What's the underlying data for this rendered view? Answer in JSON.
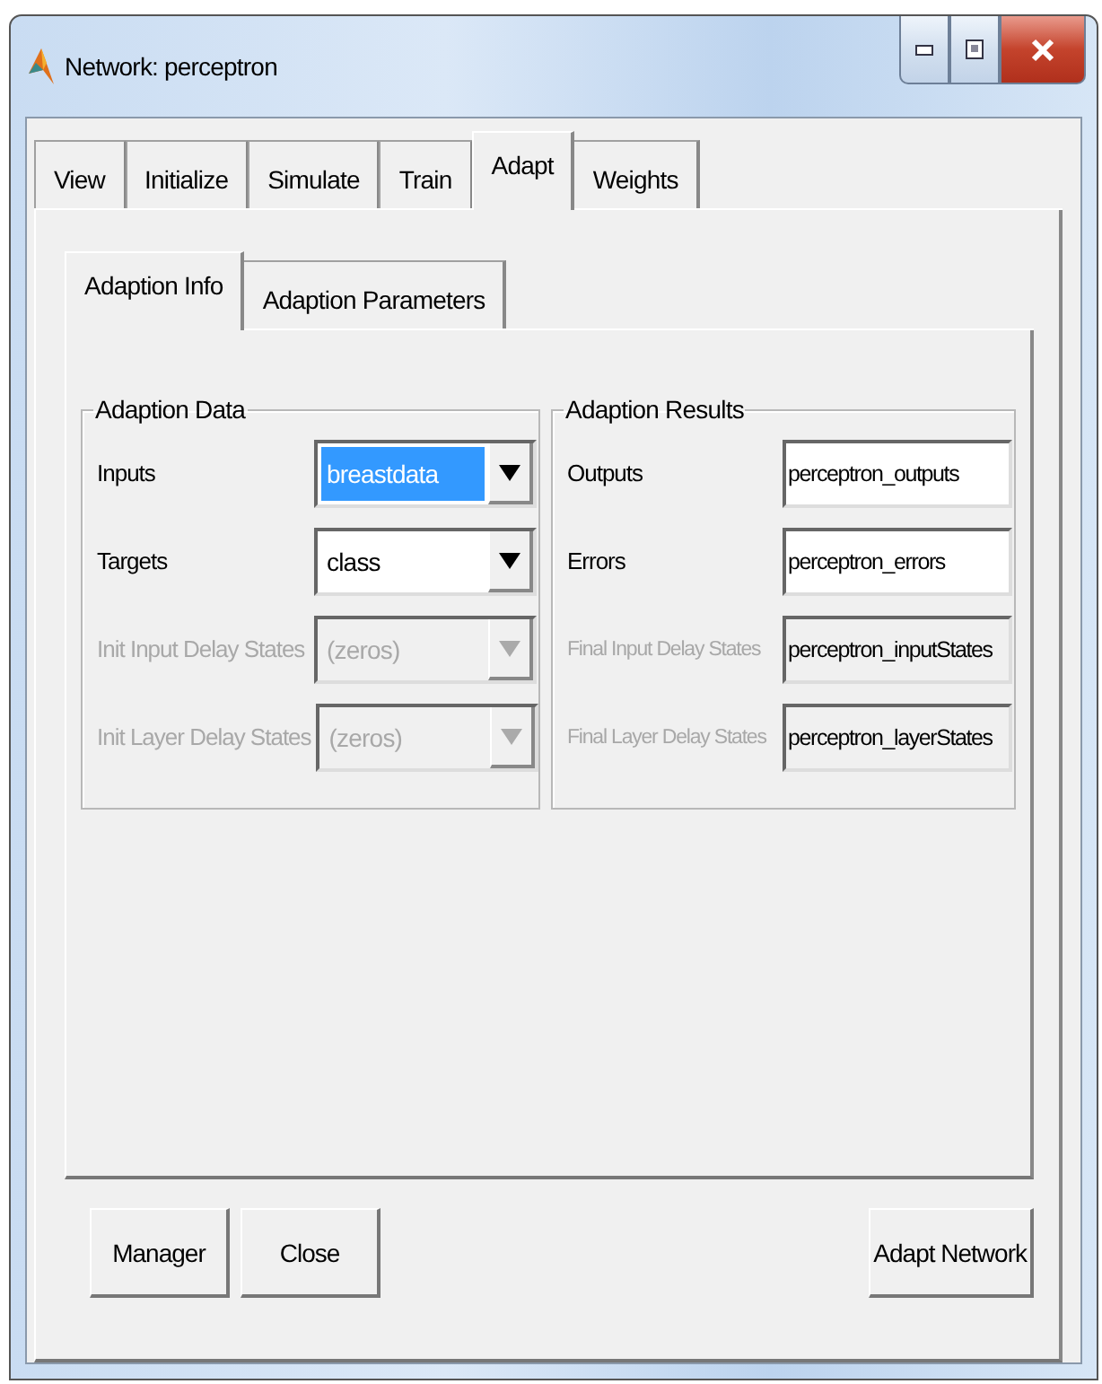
{
  "window": {
    "title": "Network: perceptron"
  },
  "tabs": [
    {
      "label": "View",
      "selected": false
    },
    {
      "label": "Initialize",
      "selected": false
    },
    {
      "label": "Simulate",
      "selected": false
    },
    {
      "label": "Train",
      "selected": false
    },
    {
      "label": "Adapt",
      "selected": true
    },
    {
      "label": "Weights",
      "selected": false
    }
  ],
  "subtabs": [
    {
      "label": "Adaption Info",
      "selected": true
    },
    {
      "label": "Adaption Parameters",
      "selected": false
    }
  ],
  "groups": [
    {
      "title": "Adaption Data",
      "fields": [
        {
          "kind": "dropdown",
          "label": "Inputs",
          "value": "breastdata",
          "disabled": false,
          "highlighted": true
        },
        {
          "kind": "dropdown",
          "label": "Targets",
          "value": "class",
          "disabled": false,
          "highlighted": false
        },
        {
          "kind": "dropdown",
          "label": "Init Input Delay States",
          "value": "(zeros)",
          "disabled": true,
          "highlighted": false
        },
        {
          "kind": "dropdown",
          "label": "Init Layer Delay States",
          "value": "(zeros)",
          "disabled": true,
          "highlighted": false
        }
      ]
    },
    {
      "title": "Adaption Results",
      "fields": [
        {
          "kind": "text",
          "label": "Outputs",
          "value": "perceptron_outputs",
          "disabled": false
        },
        {
          "kind": "text",
          "label": "Errors",
          "value": "perceptron_errors",
          "disabled": false
        },
        {
          "kind": "text",
          "label": "Final Input Delay States",
          "value": "perceptron_inputStates",
          "disabled": true
        },
        {
          "kind": "text",
          "label": "Final Layer Delay States",
          "value": "perceptron_layerStates",
          "disabled": true
        }
      ]
    }
  ],
  "buttons_left": [
    "Manager",
    "Close"
  ],
  "buttons_right": [
    "Adapt Network"
  ]
}
